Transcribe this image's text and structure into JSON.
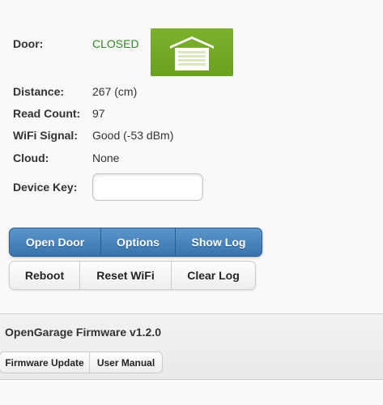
{
  "status": {
    "door_label": "Door:",
    "door_value": "CLOSED",
    "door_icon": "garage-door-closed-icon",
    "distance_label": "Distance:",
    "distance_value": "267 (cm)",
    "read_count_label": "Read Count:",
    "read_count_value": "97",
    "wifi_label": "WiFi Signal:",
    "wifi_value": "Good (-53 dBm)",
    "cloud_label": "Cloud:",
    "cloud_value": "None",
    "device_key_label": "Device Key:",
    "device_key_value": ""
  },
  "actions": {
    "primary": [
      "Open Door",
      "Options",
      "Show Log"
    ],
    "secondary": [
      "Reboot",
      "Reset WiFi",
      "Clear Log"
    ]
  },
  "footer": {
    "title": "OpenGarage Firmware v1.2.0",
    "links": [
      "Firmware Update",
      "User Manual"
    ]
  },
  "colors": {
    "closed_status": "#2e8b22",
    "primary_button": "#4a86c0",
    "door_icon_bg": "#74aa27"
  }
}
